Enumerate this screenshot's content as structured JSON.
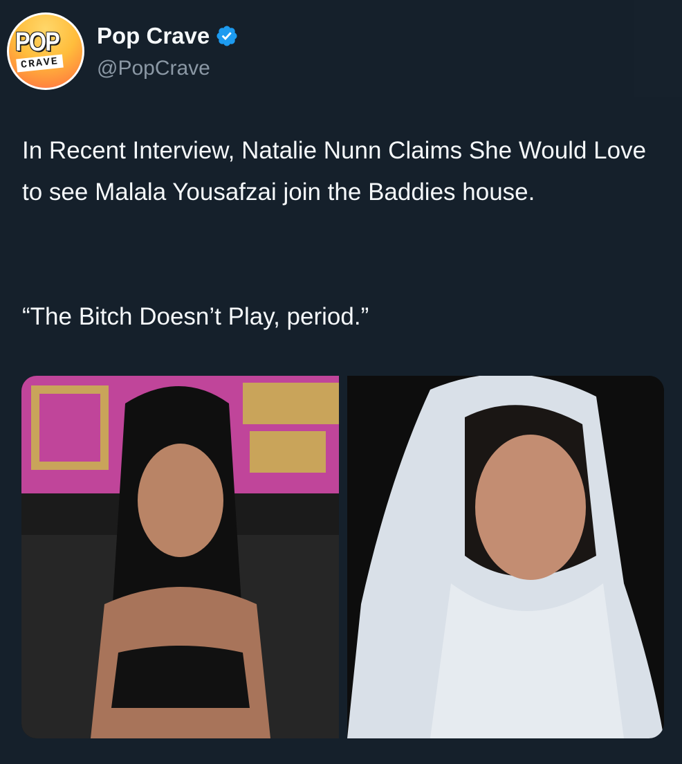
{
  "author": {
    "display_name": "Pop Crave",
    "handle": "@PopCrave",
    "verified": true,
    "avatar_logo_top": "POP",
    "avatar_logo_bottom": "CRAVE"
  },
  "tweet": {
    "text": "In Recent Interview, Natalie Nunn Claims She Would Love to see Malala Yousafzai join the Baddies house.",
    "quote": "“The Bitch Doesn’t Play, period.”"
  },
  "media": {
    "images": [
      {
        "icon": "photo-portrait-icon"
      },
      {
        "icon": "photo-portrait-icon"
      }
    ]
  },
  "colors": {
    "background": "#15202b",
    "text": "#f5f8fa",
    "secondary_text": "#8b98a5",
    "verified": "#1d9bf0"
  }
}
